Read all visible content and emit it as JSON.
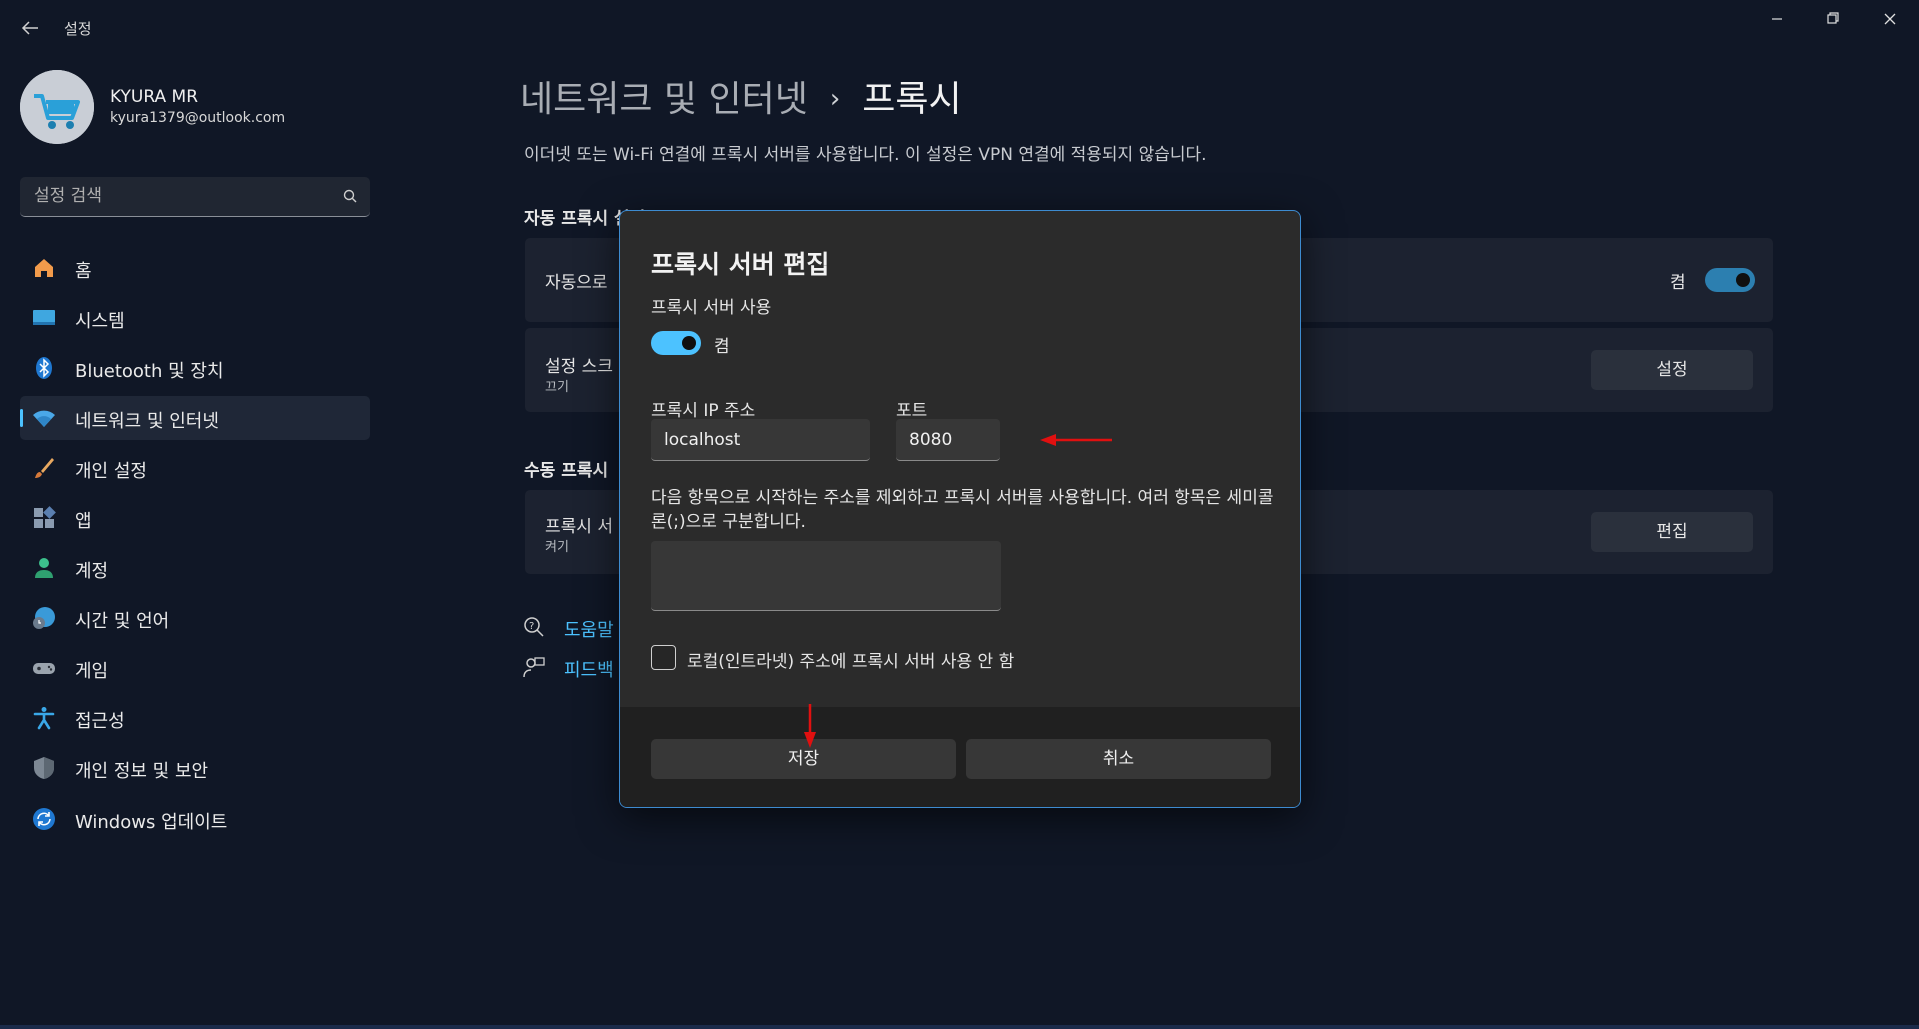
{
  "window": {
    "title": "설정",
    "back_icon": "back-arrow-icon",
    "controls": [
      "minimize-icon",
      "restore-icon",
      "close-icon"
    ]
  },
  "user": {
    "name": "KYURA MR",
    "email": "kyura1379@outlook.com"
  },
  "search": {
    "placeholder": "설정 검색"
  },
  "sidebar": {
    "items": [
      {
        "label": "홈",
        "icon": "home-icon"
      },
      {
        "label": "시스템",
        "icon": "system-icon"
      },
      {
        "label": "Bluetooth 및 장치",
        "icon": "bluetooth-icon"
      },
      {
        "label": "네트워크 및 인터넷",
        "icon": "wifi-icon",
        "active": true
      },
      {
        "label": "개인 설정",
        "icon": "brush-icon"
      },
      {
        "label": "앱",
        "icon": "apps-icon"
      },
      {
        "label": "계정",
        "icon": "account-icon"
      },
      {
        "label": "시간 및 언어",
        "icon": "globe-clock-icon"
      },
      {
        "label": "게임",
        "icon": "gamepad-icon"
      },
      {
        "label": "접근성",
        "icon": "accessibility-icon"
      },
      {
        "label": "개인 정보 및 보안",
        "icon": "shield-icon"
      },
      {
        "label": "Windows 업데이트",
        "icon": "update-icon"
      }
    ]
  },
  "main": {
    "breadcrumb_parent": "네트워크 및 인터넷",
    "breadcrumb_sep": "›",
    "breadcrumb_current": "프록시",
    "description": "이더넷 또는 Wi-Fi 연결에 프록시 서버를 사용합니다. 이 설정은 VPN 연결에 적용되지 않습니다.",
    "auto_section_title": "자동 프록시 설정",
    "auto_detect_label": "자동으로",
    "auto_detect_toggle_text": "켬",
    "setup_script_label": "설정 스크",
    "setup_script_sub": "끄기",
    "setup_script_button": "설정",
    "manual_section_title": "수동 프록시",
    "manual_label": "프록시 서",
    "manual_sub": "켜기",
    "manual_button": "편집",
    "help_link": "도움말",
    "feedback_link": "피드백"
  },
  "dialog": {
    "title": "프록시 서버 편집",
    "use_proxy_label": "프록시 서버 사용",
    "toggle_text": "켬",
    "ip_label": "프록시 IP 주소",
    "ip_value": "localhost",
    "port_label": "포트",
    "port_value": "8080",
    "exceptions_desc": "다음 항목으로 시작하는 주소를 제외하고 프록시 서버를 사용합니다. 여러 항목은 세미콜론(;)으로 구분합니다.",
    "exceptions_value": "",
    "local_checkbox_label": "로컬(인트라넷) 주소에 프록시 서버 사용 안 함",
    "local_checkbox_checked": false,
    "save_button": "저장",
    "cancel_button": "취소"
  },
  "colors": {
    "accent": "#4cc2ff",
    "annotation": "#e01010",
    "background": "#101726"
  }
}
